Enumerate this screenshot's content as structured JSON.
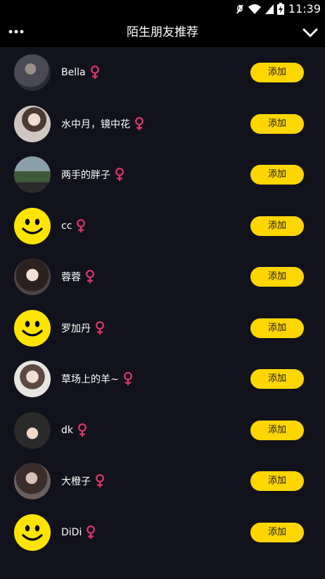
{
  "status_bar": {
    "time": "11:39",
    "icons": [
      "mute-icon",
      "wifi-icon",
      "signal-icon",
      "battery-charging-icon"
    ]
  },
  "header": {
    "title": "陌生朋友推荐",
    "more_icon": "more-dots-icon",
    "collapse_icon": "chevron-down-icon"
  },
  "colors": {
    "background": "#12121c",
    "button": "#ffd600",
    "gender_female": "#e3356a",
    "smiley": "#ffe400"
  },
  "friends": [
    {
      "name": "Bella",
      "avatar": "photo",
      "gender": "female",
      "button": "添加"
    },
    {
      "name": "水中月，镜中花",
      "avatar": "photo",
      "gender": "female",
      "button": "添加"
    },
    {
      "name": "两手的胖子",
      "avatar": "photo",
      "gender": "female",
      "button": "添加"
    },
    {
      "name": "cc",
      "avatar": "smiley",
      "gender": "female",
      "button": "添加"
    },
    {
      "name": "蓉蓉",
      "avatar": "photo",
      "gender": "female",
      "button": "添加"
    },
    {
      "name": "罗加丹",
      "avatar": "smiley",
      "gender": "female",
      "button": "添加"
    },
    {
      "name": "草场上的羊~",
      "avatar": "photo",
      "gender": "female",
      "button": "添加"
    },
    {
      "name": "dk",
      "avatar": "photo",
      "gender": "female",
      "button": "添加"
    },
    {
      "name": "大橙子",
      "avatar": "photo",
      "gender": "female",
      "button": "添加"
    },
    {
      "name": "DiDi",
      "avatar": "smiley",
      "gender": "female",
      "button": "添加"
    }
  ]
}
